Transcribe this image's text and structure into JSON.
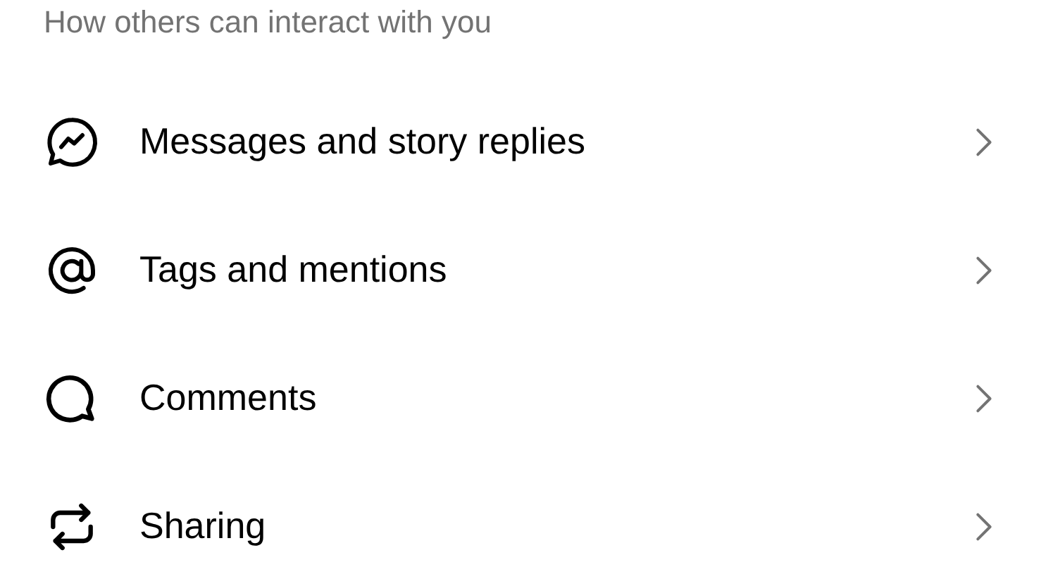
{
  "section_title": "How others can interact with you",
  "items": [
    {
      "label": "Messages and story replies"
    },
    {
      "label": "Tags and mentions"
    },
    {
      "label": "Comments"
    },
    {
      "label": "Sharing"
    }
  ]
}
